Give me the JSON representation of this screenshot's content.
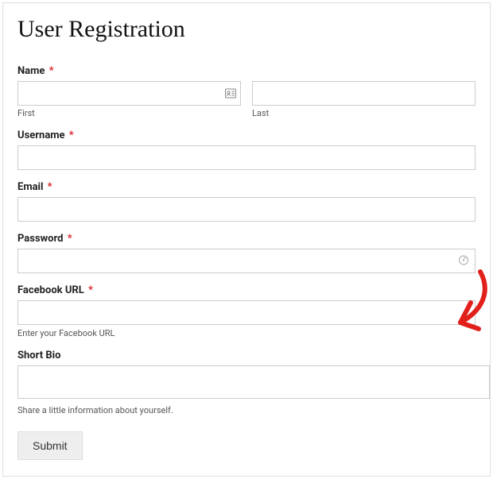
{
  "title": "User Registration",
  "fields": {
    "name": {
      "label": "Name",
      "required_marker": "*",
      "first_sub": "First",
      "last_sub": "Last"
    },
    "username": {
      "label": "Username",
      "required_marker": "*"
    },
    "email": {
      "label": "Email",
      "required_marker": "*"
    },
    "password": {
      "label": "Password",
      "required_marker": "*"
    },
    "facebook": {
      "label": "Facebook URL",
      "required_marker": "*",
      "helper": "Enter your Facebook URL"
    },
    "bio": {
      "label": "Short Bio",
      "helper": "Share a little information about yourself."
    }
  },
  "submit_label": "Submit"
}
